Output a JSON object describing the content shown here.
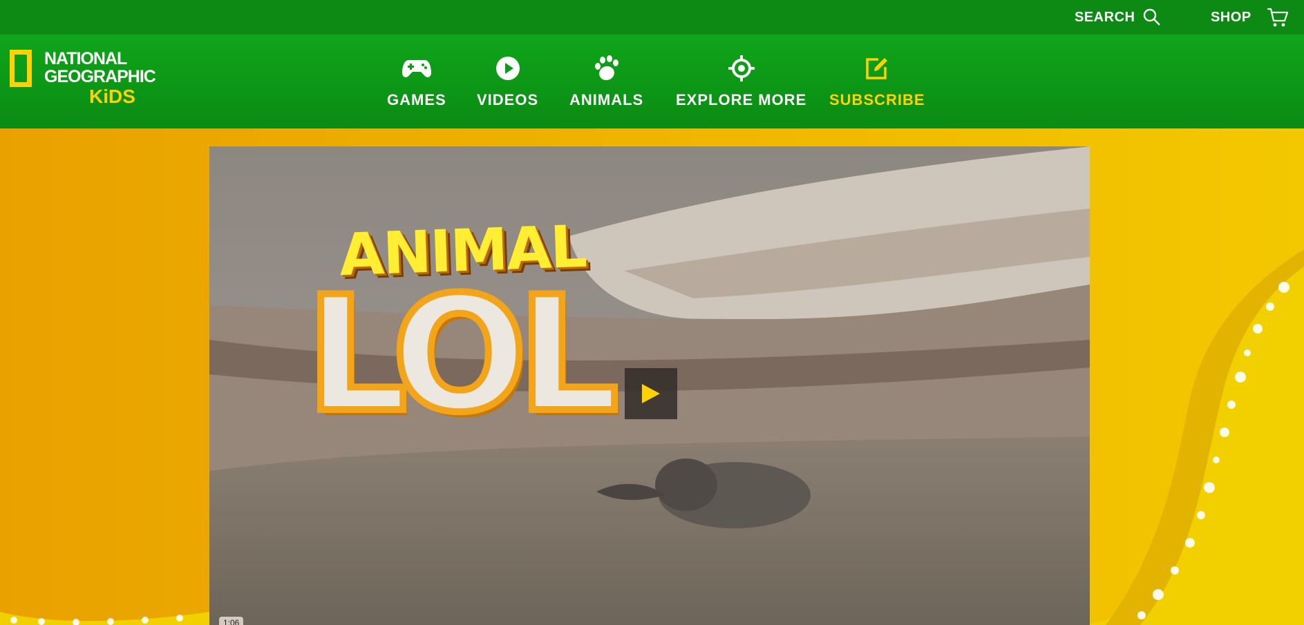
{
  "utility": {
    "search_label": "SEARCH",
    "shop_label": "SHOP"
  },
  "logo": {
    "line1": "NATIONAL",
    "line2": "GEOGRAPHIC",
    "line3": "KiDS"
  },
  "nav": {
    "items": [
      {
        "label": "GAMES",
        "icon": "gamepad-icon"
      },
      {
        "label": "VIDEOS",
        "icon": "play-circle-icon"
      },
      {
        "label": "ANIMALS",
        "icon": "paw-icon"
      },
      {
        "label": "EXPLORE MORE",
        "icon": "crosshair-icon"
      },
      {
        "label": "SUBSCRIBE",
        "icon": "edit-icon"
      }
    ]
  },
  "video": {
    "title_line1": "ANIMAL",
    "title_line2": "LOL",
    "duration": "1:06"
  },
  "colors": {
    "nav_green": "#0fa51a",
    "utility_green": "#0d8a14",
    "brand_yellow": "#ffd200",
    "background_orange": "#e9a100"
  }
}
